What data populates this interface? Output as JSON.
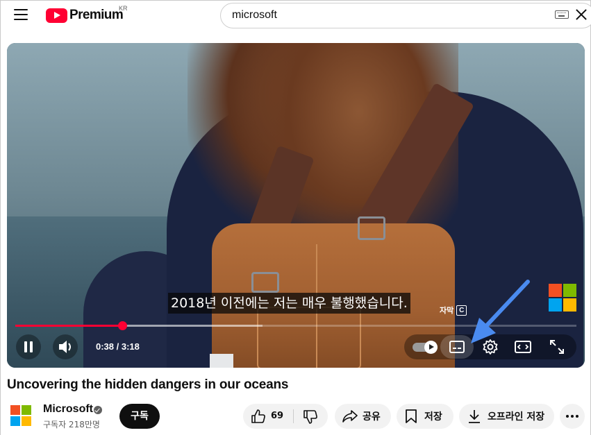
{
  "header": {
    "logo_text": "Premium",
    "region": "KR",
    "search_value": "microsoft"
  },
  "player": {
    "subtitle": "2018년 이전에는 저는 매우 불행했습니다.",
    "tooltip_label": "자막",
    "tooltip_key": "C",
    "time": "0:38 / 3:18",
    "progress_played": 0.19,
    "progress_buffered": 0.44,
    "autoplay_on": true
  },
  "video": {
    "title": "Uncovering the hidden dangers in our oceans"
  },
  "channel": {
    "name": "Microsoft",
    "subscribers": "구독자 218만명",
    "subscribe_label": "구독"
  },
  "actions": {
    "like_count": "69",
    "share_label": "공유",
    "save_label": "저장",
    "offline_label": "오프라인 저장"
  },
  "colors": {
    "brand_red": "#ff0033",
    "ms_red": "#f25022",
    "ms_green": "#7fba00",
    "ms_blue": "#00a4ef",
    "ms_yellow": "#ffb900",
    "annotation_arrow": "#3b82f6"
  },
  "icons": {
    "menu": "hamburger-icon",
    "keyboard": "keyboard-icon",
    "close": "close-icon",
    "pause": "pause-icon",
    "volume": "volume-icon",
    "captions": "captions-icon",
    "settings": "gear-icon",
    "theater": "theater-mode-icon",
    "fullscreen": "fullscreen-icon",
    "like": "thumbs-up-icon",
    "dislike": "thumbs-down-icon",
    "share": "share-icon",
    "save": "bookmark-icon",
    "download": "download-icon",
    "more": "more-horizontal-icon"
  }
}
